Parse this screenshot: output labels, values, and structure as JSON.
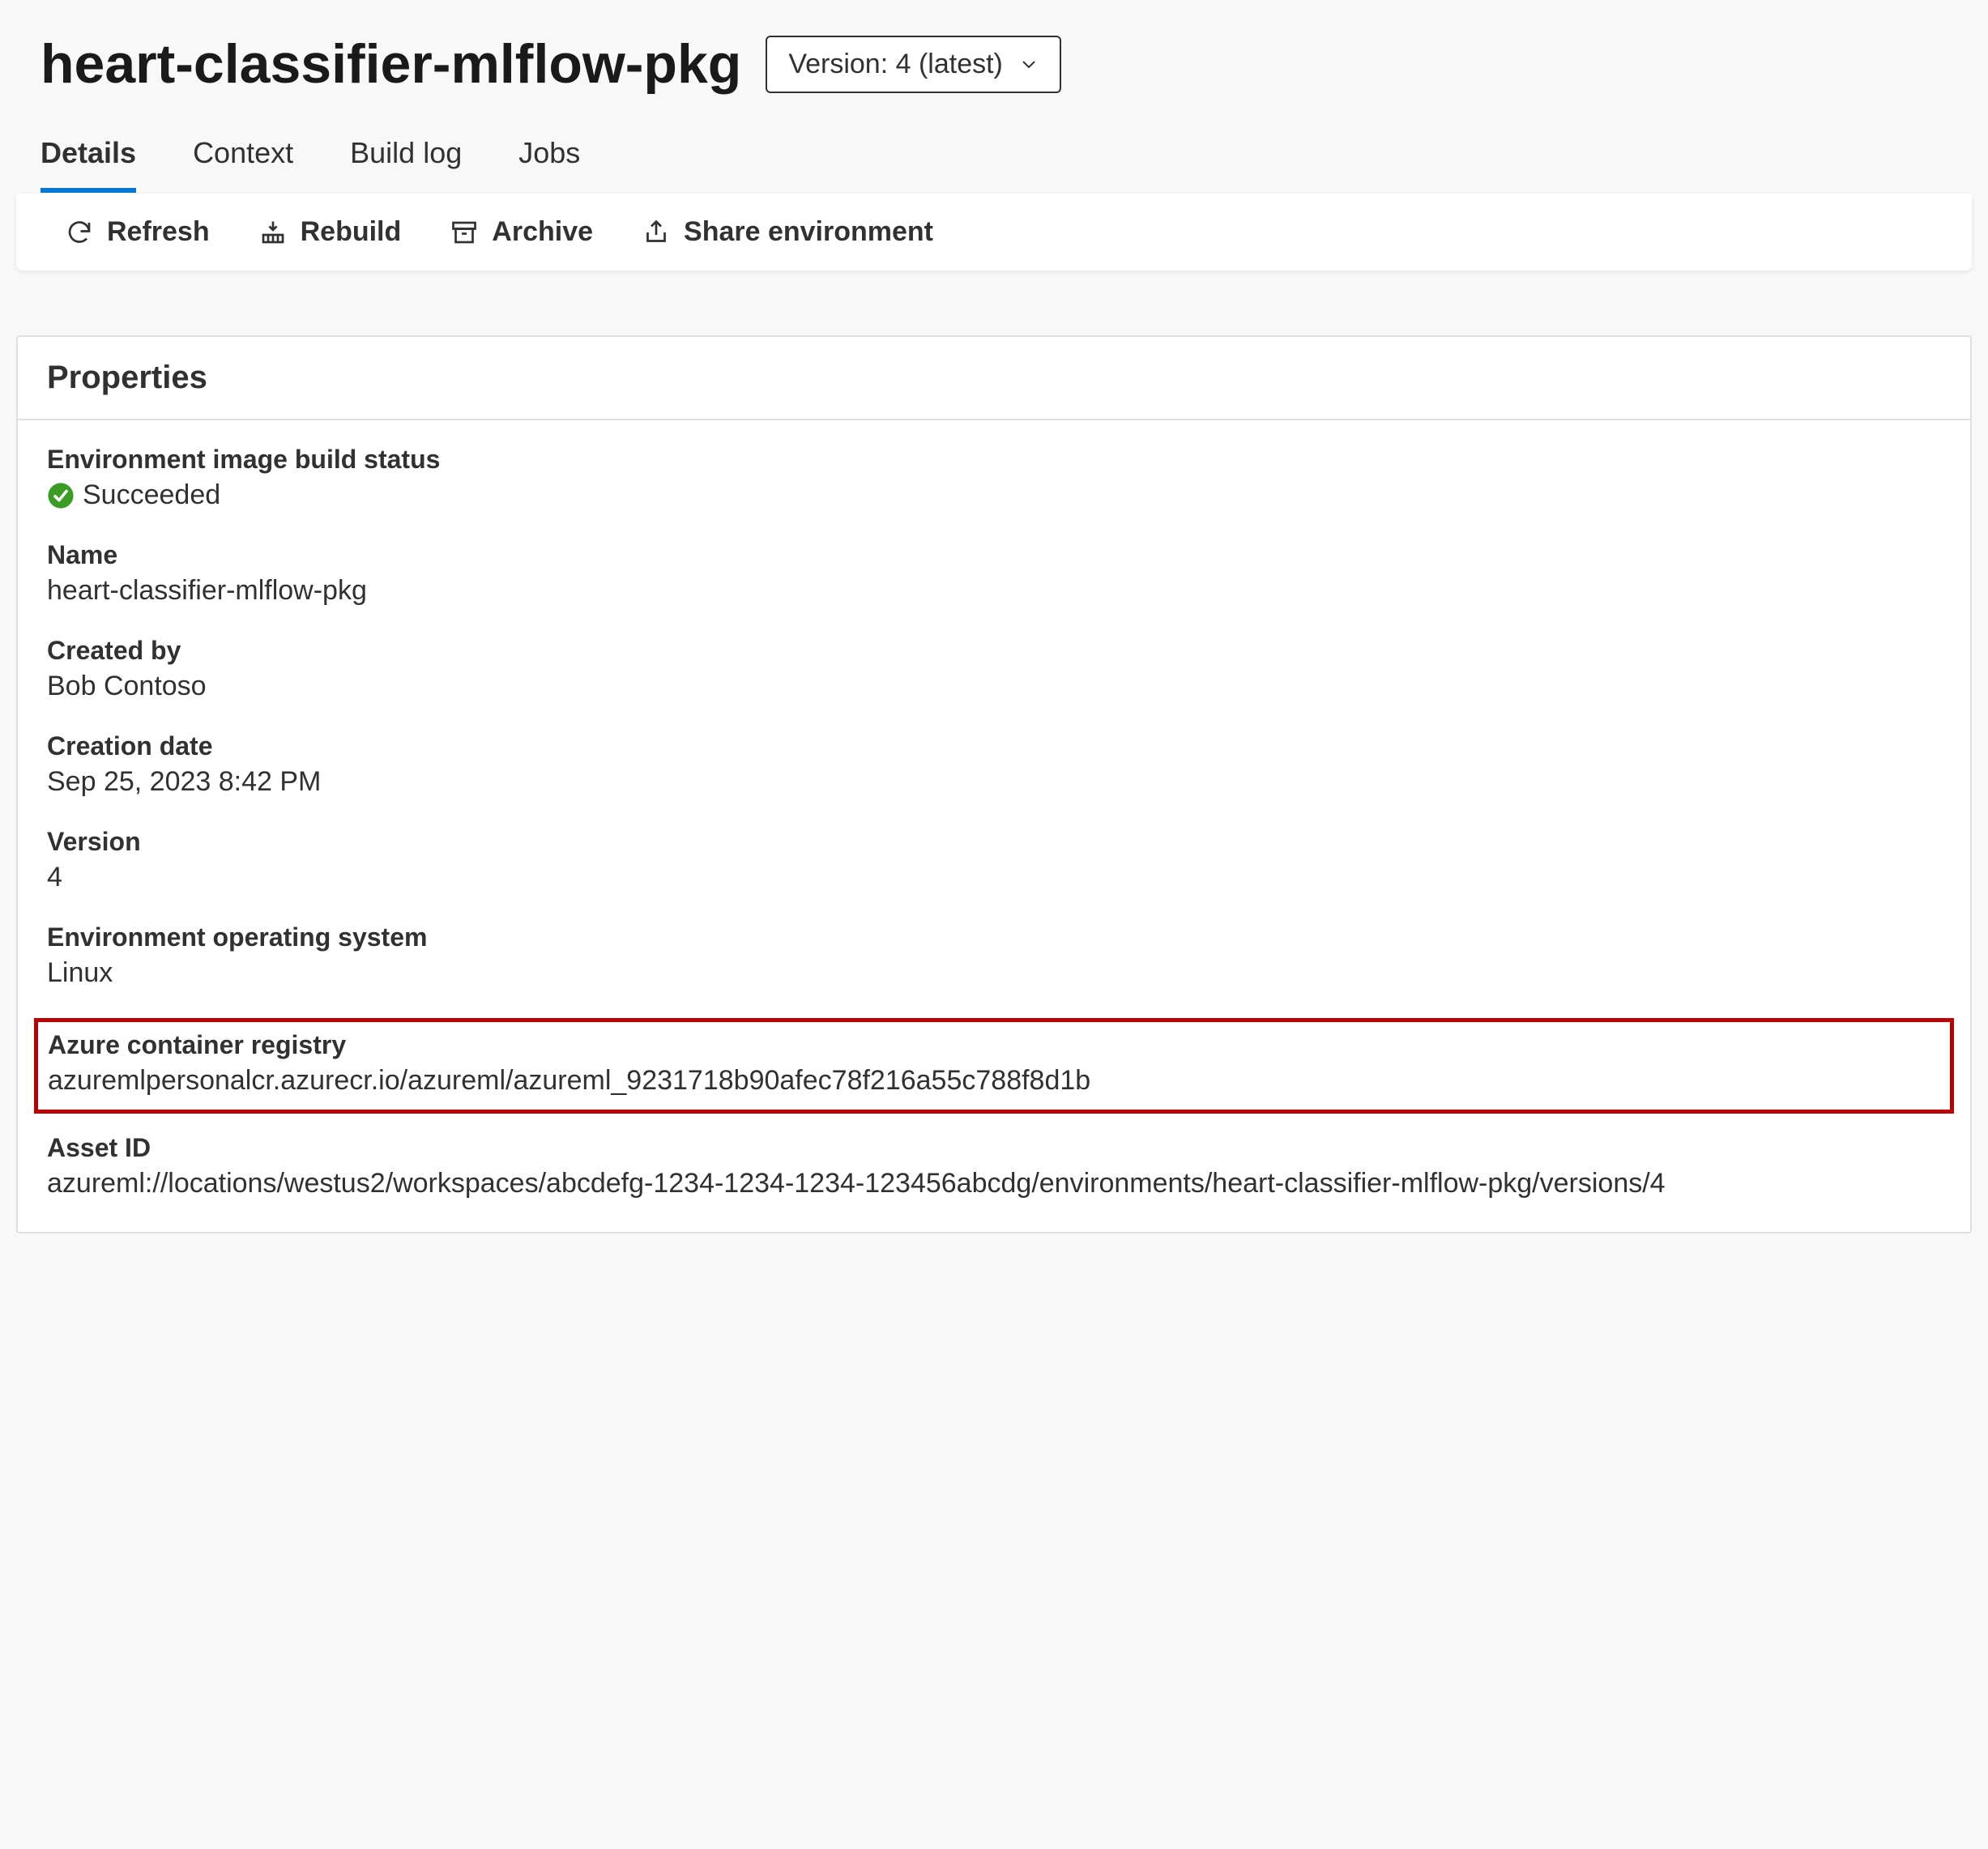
{
  "header": {
    "title": "heart-classifier-mlflow-pkg",
    "version_label": "Version: 4 (latest)"
  },
  "tabs": [
    {
      "label": "Details",
      "active": true
    },
    {
      "label": "Context",
      "active": false
    },
    {
      "label": "Build log",
      "active": false
    },
    {
      "label": "Jobs",
      "active": false
    }
  ],
  "toolbar": {
    "refresh": "Refresh",
    "rebuild": "Rebuild",
    "archive": "Archive",
    "share": "Share environment"
  },
  "properties": {
    "title": "Properties",
    "build_status_label": "Environment image build status",
    "build_status_value": "Succeeded",
    "name_label": "Name",
    "name_value": "heart-classifier-mlflow-pkg",
    "created_by_label": "Created by",
    "created_by_value": "Bob Contoso",
    "creation_date_label": "Creation date",
    "creation_date_value": "Sep 25, 2023 8:42 PM",
    "version_label": "Version",
    "version_value": "4",
    "os_label": "Environment operating system",
    "os_value": "Linux",
    "acr_label": "Azure container registry",
    "acr_value": "azuremlpersonalcr.azurecr.io/azureml/azureml_9231718b90afec78f216a55c788f8d1b",
    "asset_id_label": "Asset ID",
    "asset_id_value": "azureml://locations/westus2/workspaces/abcdefg-1234-1234-1234-123456abcdg/environments/heart-classifier-mlflow-pkg/versions/4"
  }
}
